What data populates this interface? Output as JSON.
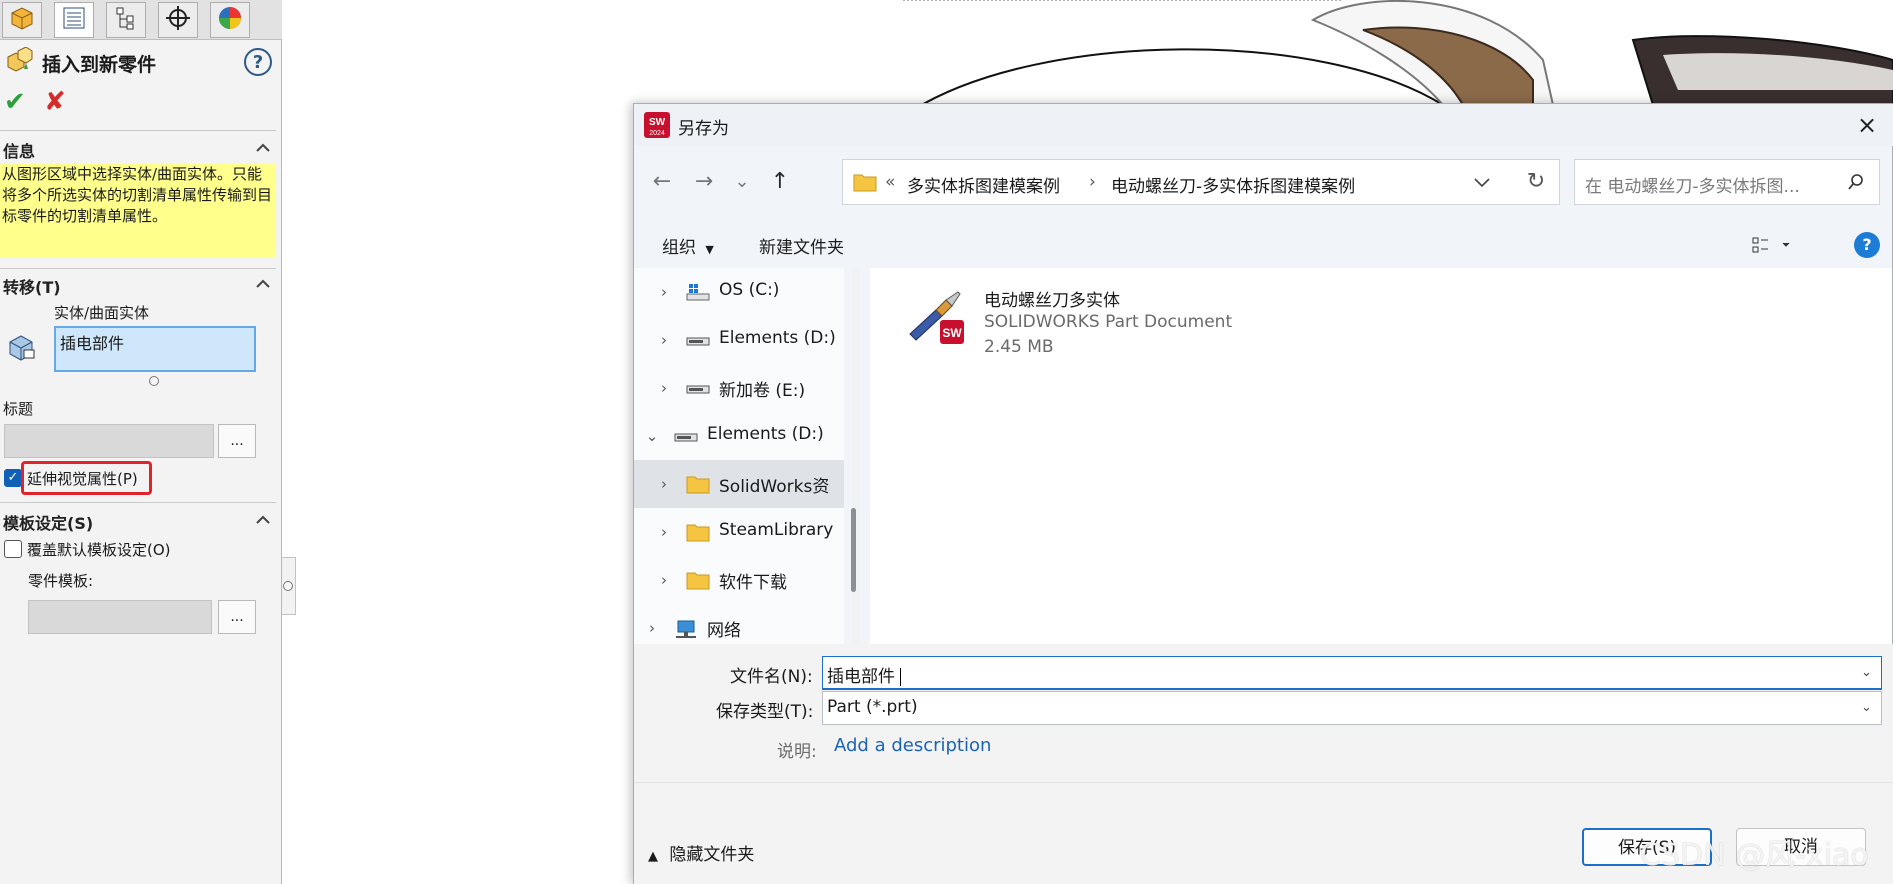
{
  "property_manager": {
    "tabs": [
      "feature-manager-icon",
      "property-manager-icon",
      "configuration-manager-icon",
      "dimxpert-icon",
      "display-manager-icon"
    ],
    "title": "插入到新零件",
    "help_icon": "?",
    "info": {
      "header": "信息",
      "text": "从图形区域中选择实体/曲面实体。只能将多个所选实体的切割清单属性传输到目标零件的切割清单属性。"
    },
    "transfer": {
      "header": "转移(T)",
      "bodies_label": "实体/曲面实体",
      "selected_body": "插电部件",
      "title_label": "标题",
      "title_value": "",
      "browse_label": "...",
      "propagate_label": "延伸视觉属性(P)",
      "propagate_checked": true
    },
    "template": {
      "header": "模板设定(S)",
      "override_label": "覆盖默认模板设定(O)",
      "override_checked": false,
      "part_template_label": "零件模板:",
      "part_template_value": "",
      "browse_label": "..."
    }
  },
  "dialog": {
    "title": "另存为",
    "app_badge": "SW",
    "app_badge_year": "2024",
    "close": "×",
    "nav": {
      "back": "←",
      "forward": "→",
      "recent": "⌄",
      "up": "↑",
      "refresh": "↻"
    },
    "address": {
      "overflow": "«",
      "segments": [
        "多实体拆图建模案例",
        "电动螺丝刀-多实体拆图建模案例"
      ],
      "separator": "›"
    },
    "search_placeholder": "在 电动螺丝刀-多实体拆图...",
    "toolbar": {
      "organize": "组织",
      "new_folder": "新建文件夹",
      "help": "?"
    },
    "tree": [
      {
        "label": "OS (C:)",
        "icon": "drive-os-icon",
        "expanded": false,
        "indent": 1
      },
      {
        "label": "Elements (D:)",
        "icon": "drive-icon",
        "expanded": false,
        "indent": 1
      },
      {
        "label": "新加卷 (E:)",
        "icon": "drive-icon",
        "expanded": false,
        "indent": 1
      },
      {
        "label": "Elements (D:)",
        "icon": "drive-icon",
        "expanded": true,
        "indent": 0
      },
      {
        "label": "SolidWorks资",
        "icon": "folder-icon",
        "expanded": false,
        "indent": 1,
        "selected": true
      },
      {
        "label": "SteamLibrary",
        "icon": "folder-icon",
        "expanded": false,
        "indent": 1
      },
      {
        "label": "软件下载",
        "icon": "folder-icon",
        "expanded": false,
        "indent": 1
      },
      {
        "label": "网络",
        "icon": "network-icon",
        "expanded": false,
        "indent": 0
      }
    ],
    "files": [
      {
        "name": "电动螺丝刀多实体",
        "type": "SOLIDWORKS Part Document",
        "size": "2.45 MB"
      }
    ],
    "filename_label": "文件名(N):",
    "filename_value": "插电部件",
    "savetype_label": "保存类型(T):",
    "savetype_value": "Part (*.prt)",
    "description_label": "说明:",
    "description_link": "Add a description",
    "hide_folders": "隐藏文件夹",
    "save_button": "保存(S)",
    "cancel_button": "取消"
  },
  "watermark": "CSDN @风-xiao",
  "colors": {
    "info_bg": "#ffff8c",
    "selection_bg": "#cfe7fb",
    "highlight_red": "#e0242c",
    "link_blue": "#1a63b8",
    "accent_blue": "#1d6fc9"
  }
}
